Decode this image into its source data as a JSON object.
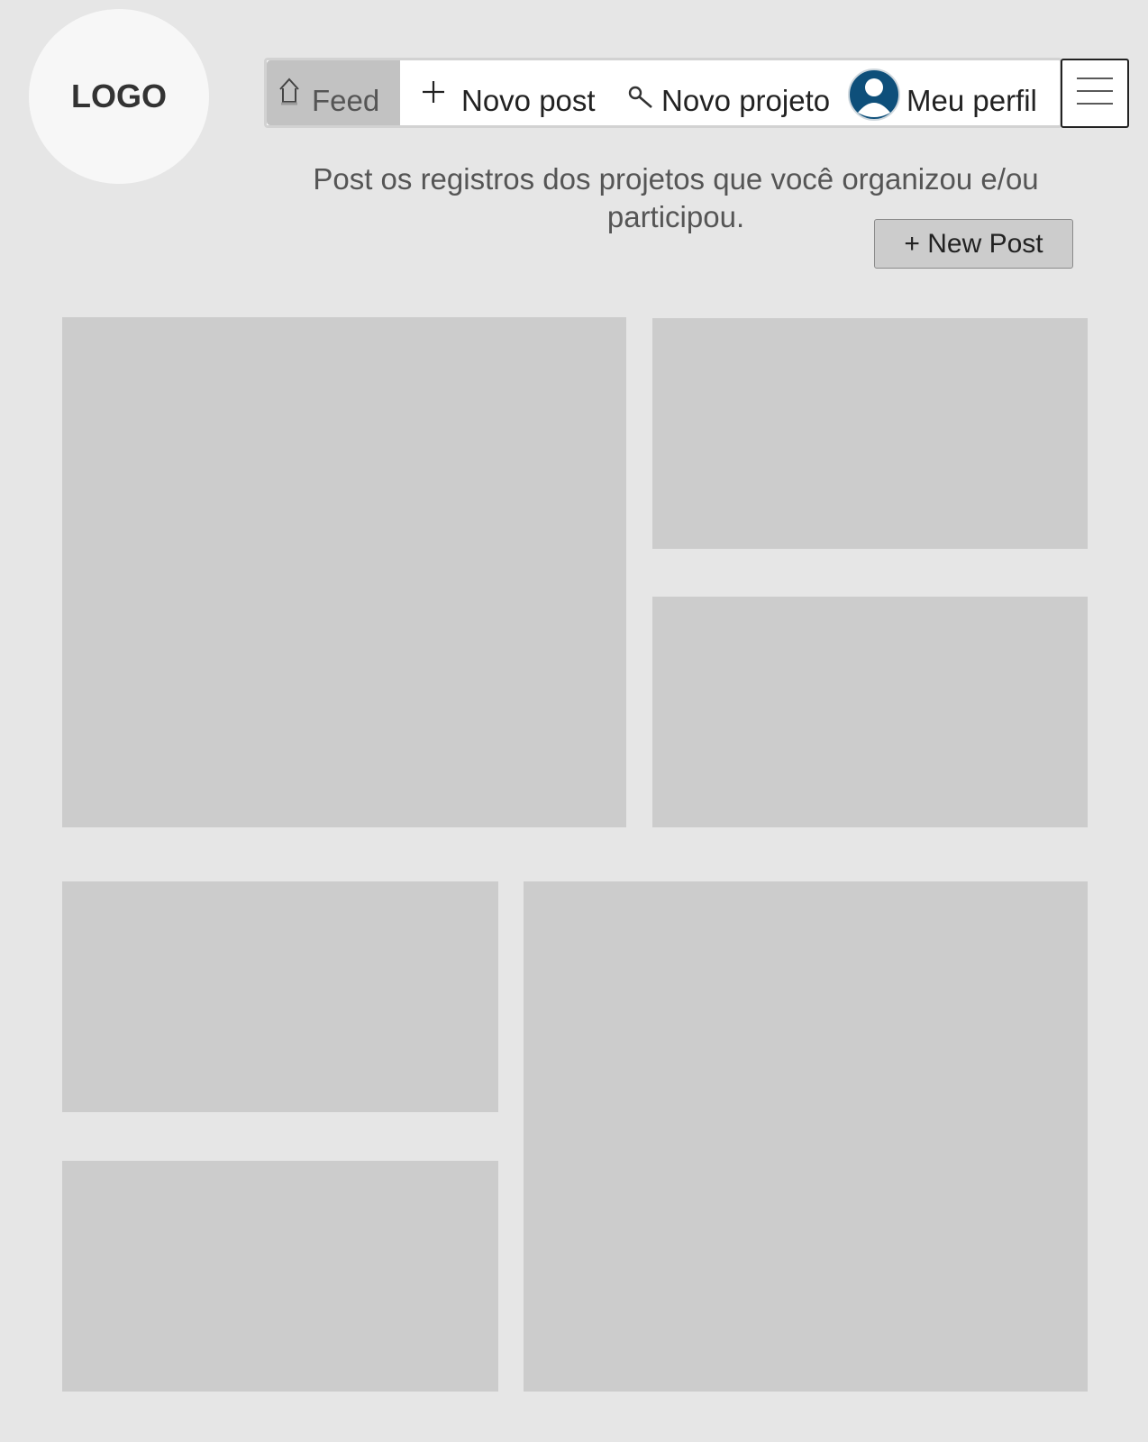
{
  "logo": {
    "text": "LOGO"
  },
  "nav": {
    "feed": {
      "label": "Feed",
      "icon": "home-icon"
    },
    "novo_post": {
      "label": "Novo post",
      "icon": "plus-icon"
    },
    "novo_projeto": {
      "label": "Novo projeto",
      "icon": "search-icon"
    },
    "meu_perfil": {
      "label": "Meu perfil",
      "icon": "user-avatar-icon"
    },
    "menu": {
      "icon": "hamburger-menu-icon"
    }
  },
  "header": {
    "subtitle": "Post os registros dos projetos que você organizou e/ou participou.",
    "new_post_button": "+ New Post"
  },
  "colors": {
    "background": "#e6e6e6",
    "card": "#cccccc",
    "active_tab": "#c2c2c2",
    "avatar": "#0e4f7a"
  },
  "feed": {
    "cards": [
      "post-card",
      "post-card",
      "post-card",
      "post-card",
      "post-card",
      "post-card"
    ]
  }
}
